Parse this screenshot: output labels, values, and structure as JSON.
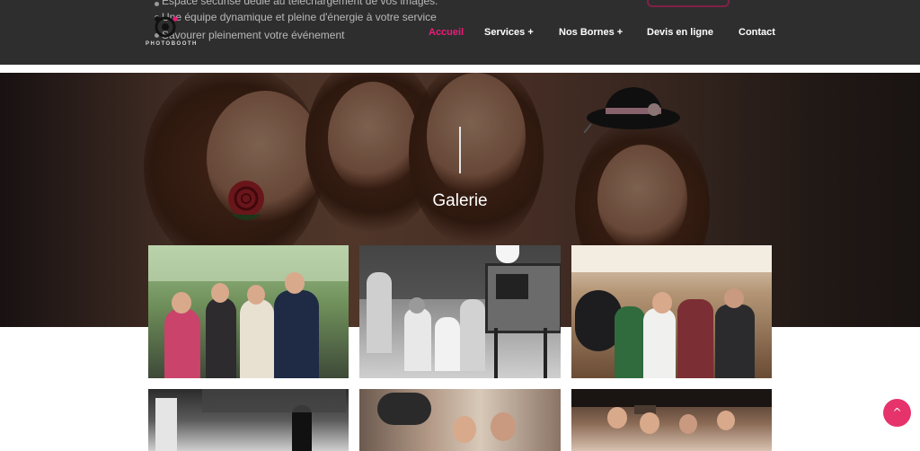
{
  "header": {
    "underlay_lines": [
      "Espace sécurisé dédié au téléchargement de vos images.",
      "Une équipe dynamique et pleine d'énergie à votre service",
      "Savourer pleinement votre événement"
    ],
    "logo": {
      "text": "PHOTOBOOTH"
    },
    "nav": [
      {
        "label": "Accueil",
        "active": true
      },
      {
        "label": "Services +",
        "active": false
      },
      {
        "label": "Nos Bornes +",
        "active": false
      },
      {
        "label": "Devis en ligne",
        "active": false
      },
      {
        "label": "Contact",
        "active": false
      }
    ],
    "colors": {
      "background": "#2e2e2e",
      "accent": "#e91e79"
    }
  },
  "hero": {
    "title": "Galerie",
    "description_icons": [
      "bowler-hat-prop",
      "rose-prop"
    ]
  },
  "gallery": {
    "items": [
      {
        "name": "gallery-photo-1",
        "style": "color"
      },
      {
        "name": "gallery-photo-2",
        "style": "black-and-white"
      },
      {
        "name": "gallery-photo-3",
        "style": "color"
      },
      {
        "name": "gallery-photo-4",
        "style": "black-and-white"
      },
      {
        "name": "gallery-photo-5",
        "style": "color"
      },
      {
        "name": "gallery-photo-6",
        "style": "color"
      }
    ]
  },
  "scroll_top": {
    "icon": "chevron-up-icon",
    "glyph": "^",
    "color": "#e6336b"
  }
}
